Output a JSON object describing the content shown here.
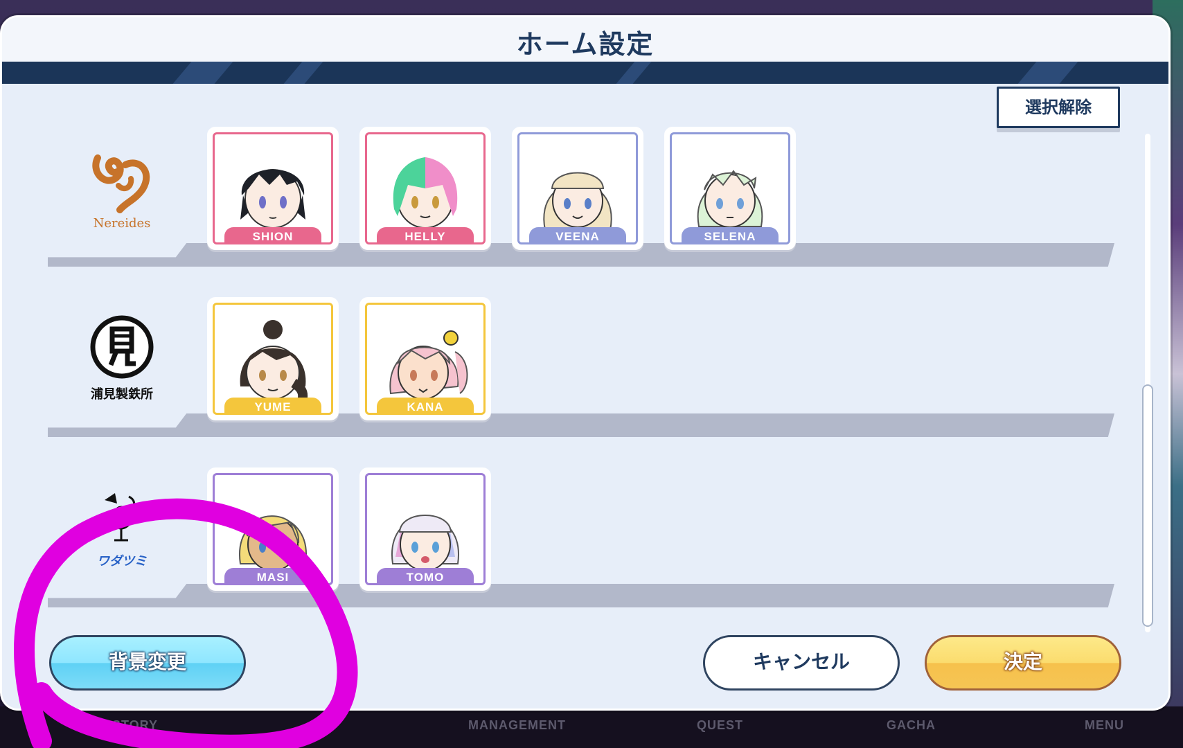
{
  "modal": {
    "title": "ホーム設定",
    "deselect_label": "選択解除"
  },
  "groups": [
    {
      "logo_text": "Nereides",
      "characters": [
        {
          "name": "SHION",
          "color": "#e8678d"
        },
        {
          "name": "HELLY",
          "color": "#e8678d"
        },
        {
          "name": "VEENA",
          "color": "#8f9ad9"
        },
        {
          "name": "SELENA",
          "color": "#8f9ad9"
        }
      ]
    },
    {
      "logo_text": "浦見製鉄所",
      "characters": [
        {
          "name": "YUME",
          "color": "#f4c63c"
        },
        {
          "name": "KANA",
          "color": "#f4c63c"
        }
      ]
    },
    {
      "logo_text": "ワダツミ",
      "characters": [
        {
          "name": "MASI",
          "color": "#9e7ed6"
        },
        {
          "name": "TOMO",
          "color": "#9e7ed6"
        }
      ]
    }
  ],
  "buttons": {
    "background_change": "背景変更",
    "cancel": "キャンセル",
    "confirm": "決定"
  },
  "bottom_nav": [
    "STORY",
    "MANAGEMENT",
    "QUEST",
    "GACHA",
    "MENU"
  ],
  "colors": {
    "title_band": "#1b3558",
    "annotation": "#e000e0"
  }
}
